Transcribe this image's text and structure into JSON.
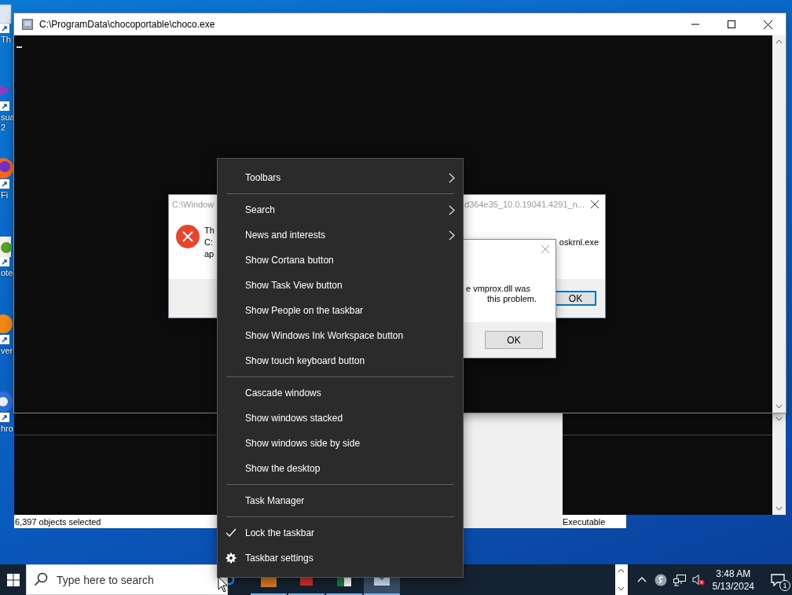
{
  "desktop_icons": [
    {
      "label": [
        "Th"
      ]
    },
    {
      "label": [
        "sua",
        "2"
      ]
    },
    {
      "label": [
        "Fi"
      ]
    },
    {
      "label": [
        "ote"
      ]
    },
    {
      "label": [
        "ver"
      ]
    },
    {
      "label": [
        "hro"
      ]
    }
  ],
  "console_window": {
    "title": "C:\\ProgramData\\chocoportable\\choco.exe"
  },
  "explorer_window": {
    "status_text": "6,397 objects selected",
    "type_text": "Executable"
  },
  "error_dialog": {
    "title_start": "C:\\Window",
    "title_end": "d364e35_10.0.19041.4291_n...",
    "message_lines": [
      "Th",
      "C:",
      "ap"
    ],
    "message_end": "oskrnl.exe",
    "button": "OK"
  },
  "dll_dialog": {
    "message_lines": [
      "e vmprox.dll was",
      "this problem."
    ],
    "button": "OK"
  },
  "context_menu": {
    "sections": [
      [
        {
          "label": "Toolbars",
          "kind": "submenu",
          "checked": false
        }
      ],
      [
        {
          "label": "Search",
          "kind": "submenu",
          "checked": false
        },
        {
          "label": "News and interests",
          "kind": "submenu",
          "checked": false
        },
        {
          "label": "Show Cortana button",
          "kind": "command",
          "checked": false
        },
        {
          "label": "Show Task View button",
          "kind": "command",
          "checked": false
        },
        {
          "label": "Show People on the taskbar",
          "kind": "command",
          "checked": false
        },
        {
          "label": "Show Windows Ink Workspace button",
          "kind": "command",
          "checked": false
        },
        {
          "label": "Show touch keyboard button",
          "kind": "command",
          "checked": false
        }
      ],
      [
        {
          "label": "Cascade windows",
          "kind": "command",
          "checked": false
        },
        {
          "label": "Show windows stacked",
          "kind": "command",
          "checked": false
        },
        {
          "label": "Show windows side by side",
          "kind": "command",
          "checked": false
        },
        {
          "label": "Show the desktop",
          "kind": "command",
          "checked": false
        }
      ],
      [
        {
          "label": "Task Manager",
          "kind": "command",
          "checked": false
        }
      ],
      [
        {
          "label": "Lock the taskbar",
          "kind": "toggle",
          "checked": true
        },
        {
          "label": "Taskbar settings",
          "kind": "settings",
          "checked": false
        }
      ]
    ]
  },
  "taskbar": {
    "search_placeholder": "Type here to search",
    "apps": [
      {
        "selected": false
      },
      {
        "selected": false
      },
      {
        "selected": false
      },
      {
        "selected": true
      }
    ],
    "time": "3:48 AM",
    "date": "5/13/2024",
    "notification_count": "1"
  }
}
